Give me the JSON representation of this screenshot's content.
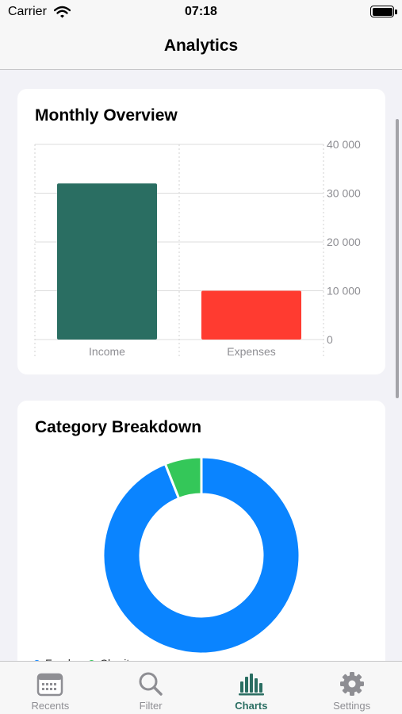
{
  "status_bar": {
    "carrier": "Carrier",
    "time": "07:18"
  },
  "nav": {
    "title": "Analytics"
  },
  "colors": {
    "income": "#2a6e62",
    "expenses": "#ff3b30",
    "blue": "#0a84ff",
    "green": "#34c759",
    "accent": "#2a6e62"
  },
  "cards": {
    "monthly": {
      "title": "Monthly Overview"
    },
    "category": {
      "title": "Category Breakdown"
    }
  },
  "chart_data": [
    {
      "type": "bar",
      "title": "Monthly Overview",
      "categories": [
        "Income",
        "Expenses"
      ],
      "values": [
        32000,
        10000
      ],
      "ylim": [
        0,
        40000
      ],
      "yticks": [
        0,
        10000,
        20000,
        30000,
        40000
      ],
      "ytick_labels": [
        "0",
        "10 000",
        "20 000",
        "30 000",
        "40 000"
      ],
      "y_axis_position": "right",
      "grid": true
    },
    {
      "type": "pie",
      "title": "Category Breakdown",
      "donut": true,
      "series": [
        {
          "name": "Food",
          "value": 94,
          "color": "#0a84ff"
        },
        {
          "name": "Charity",
          "value": 6,
          "color": "#34c759"
        }
      ]
    }
  ],
  "tabs": [
    {
      "label": "Recents",
      "icon": "calendar-icon",
      "active": false
    },
    {
      "label": "Filter",
      "icon": "search-icon",
      "active": false
    },
    {
      "label": "Charts",
      "icon": "bar-chart-icon",
      "active": true
    },
    {
      "label": "Settings",
      "icon": "gear-icon",
      "active": false
    }
  ]
}
